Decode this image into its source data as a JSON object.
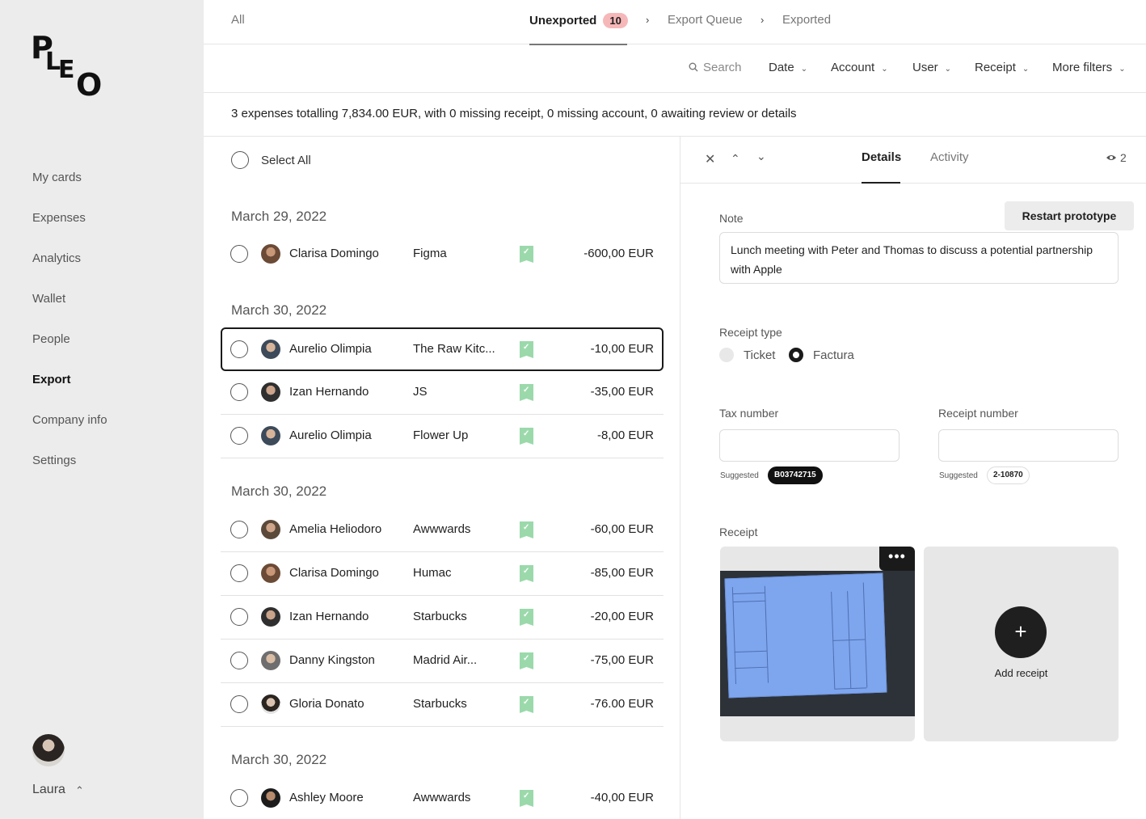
{
  "sidebar": {
    "logo": [
      "P",
      "L",
      "E",
      "O"
    ],
    "items": [
      {
        "label": "My cards"
      },
      {
        "label": "Expenses"
      },
      {
        "label": "Analytics"
      },
      {
        "label": "Wallet"
      },
      {
        "label": "People"
      },
      {
        "label": "Export",
        "active": true
      },
      {
        "label": "Company info"
      },
      {
        "label": "Settings"
      }
    ],
    "user_name": "Laura",
    "user_chevron": "chevron-up-icon"
  },
  "tabs": {
    "all": "All",
    "unexported": "Unexported",
    "unexported_count": "10",
    "export_queue": "Export Queue",
    "exported": "Exported"
  },
  "filters": {
    "search": "Search",
    "date": "Date",
    "account": "Account",
    "user": "User",
    "receipt": "Receipt",
    "more": "More filters"
  },
  "summary": "3 expenses totalling 7,834.00 EUR, with 0 missing receipt, 0 missing account, 0 awaiting review or details",
  "list": {
    "select_all": "Select All",
    "groups": [
      {
        "date": "March 29, 2022",
        "rows": [
          {
            "name": "Clarisa Domingo",
            "merchant": "Figma",
            "amount": "-600,00 EUR"
          }
        ]
      },
      {
        "date": "March 30, 2022",
        "rows": [
          {
            "name": "Aurelio Olimpia",
            "merchant": "The Raw Kitc...",
            "amount": "-10,00 EUR",
            "selected": true
          },
          {
            "name": "Izan Hernando",
            "merchant": "JS",
            "amount": "-35,00 EUR"
          },
          {
            "name": "Aurelio Olimpia",
            "merchant": "Flower Up",
            "amount": "-8,00 EUR"
          }
        ]
      },
      {
        "date": "March 30, 2022",
        "rows": [
          {
            "name": "Amelia Heliodoro",
            "merchant": "Awwwards",
            "amount": "-60,00 EUR"
          },
          {
            "name": "Clarisa Domingo",
            "merchant": "Humac",
            "amount": "-85,00 EUR"
          },
          {
            "name": "Izan Hernando",
            "merchant": "Starbucks",
            "amount": "-20,00 EUR"
          },
          {
            "name": "Danny Kingston",
            "merchant": "Madrid Air...",
            "amount": "-75,00 EUR"
          },
          {
            "name": "Gloria Donato",
            "merchant": "Starbucks",
            "amount": "-76.00 EUR"
          }
        ]
      },
      {
        "date": "March 30, 2022",
        "rows": [
          {
            "name": "Ashley Moore",
            "merchant": "Awwwards",
            "amount": "-40,00 EUR"
          }
        ]
      }
    ]
  },
  "detail": {
    "tab_details": "Details",
    "tab_activity": "Activity",
    "viewers": "2",
    "restart": "Restart prototype",
    "note_label": "Note",
    "note_text": "Lunch meeting with Peter and Thomas to discuss a potential partnership with Apple",
    "receipt_type_label": "Receipt type",
    "receipt_type_ticket": "Ticket",
    "receipt_type_factura": "Factura",
    "receipt_type_selected": "Factura",
    "tax_label": "Tax number",
    "receipt_number_label": "Receipt number",
    "suggested_label": "Suggested",
    "tax_suggestion": "B03742715",
    "receipt_suggestion": "2-10870",
    "receipt_label": "Receipt",
    "add_receipt": "Add receipt"
  },
  "colors": {
    "badge": "#f6b7b9",
    "receipt_ok": "#9bd9ab",
    "sidebar_bg": "#ececec"
  }
}
